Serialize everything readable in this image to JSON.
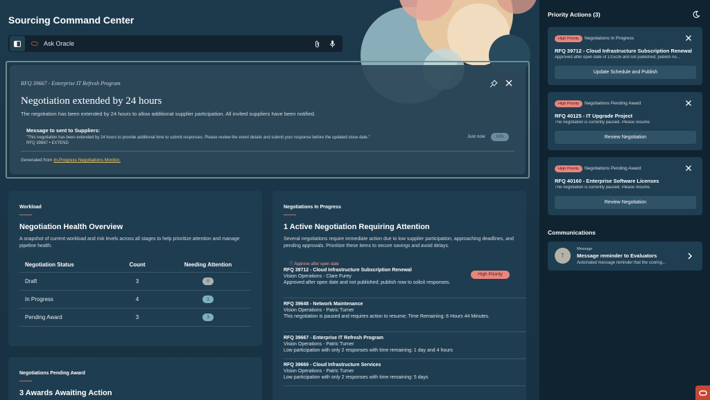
{
  "app": {
    "title": "Sourcing Command Center"
  },
  "search": {
    "placeholder": "Ask Oracle"
  },
  "alert": {
    "rfq": "RFQ 39667 - Enterprise IT Refresh Program",
    "headline": "Negotiation extended by 24 hours",
    "subtitle": "The negotiation has been extended by 24 hours to allow additional supplier participation. All invited suppliers have been notified.",
    "message_title": "Message to sent to Suppliers:",
    "message_body": "\"This negotiation has been extended by 24 hours to provide additional time to submit responses. Please review the event details and submit your response before the updated close date.\"",
    "message_ref": "RFQ 39667 • EXTEND",
    "time": "Just now",
    "tag": "Info",
    "generated_prefix": "Generated from",
    "generated_link": "In-Progress Negotiations Monitor."
  },
  "workload": {
    "kicker": "Workload",
    "title": "Negotiation Health Overview",
    "desc": "A snapshot of current workload and risk levels across all stages to help prioritize attention and manage pipeline health.",
    "columns": [
      "Negotiation Status",
      "Count",
      "Needing Attention"
    ],
    "rows": [
      {
        "status": "Draft",
        "count": "3",
        "attention": "0"
      },
      {
        "status": "In Progress",
        "count": "4",
        "attention": "1"
      },
      {
        "status": "Pending Award",
        "count": "3",
        "attention": "3"
      }
    ]
  },
  "pending_award": {
    "kicker": "Negotiations Pending Award",
    "title": "3 Awards Awaiting Action"
  },
  "in_progress": {
    "kicker": "Negotiations In Progress",
    "title": "1 Active Negotiation Requiring Attention",
    "desc": "Several negotiations require immediate action due to low supplier participation, approaching deadlines, and pending approvals. Prioritize these items to secure savings and avoid delays.",
    "flag": "Approve after open date",
    "badge": "High Priority",
    "items": [
      {
        "title": "RFQ 39712 - Cloud Infrastructure Subscription Renewal",
        "owner": "Vision Operations - Clare Furey",
        "desc": "Approved after open date and not published; publish now to solicit responses."
      },
      {
        "title": "RFQ 39648 - Network Maintenance",
        "owner": "Vision Operations - Patric Turner",
        "desc": "This negotiation is paused and requires action to resume; Time Remaining: 6 Hours 44 Minutes."
      },
      {
        "title": "RFQ 39667 - Enterprise IT Refresh Program",
        "owner": "Vision Operations - Patric Turner",
        "desc": "Low participation with only 2 responses with time remaining: 1 day and 4 hours"
      },
      {
        "title": "RFQ 39669 - Cloud Infrastructure Services",
        "owner": "Vision Operations - Patric Turner",
        "desc": "Low participation with only 2 responses with time remaining: 5 days"
      }
    ]
  },
  "priority": {
    "title": "Priority Actions (3)",
    "cards": [
      {
        "badge": "High Priority",
        "status": "Negotiations In Progress",
        "title": "RFQ 39712 - Cloud Infrastructure Subscription Renewal",
        "desc": "Approved after open date of 1/15/26 and not published; publish no...",
        "button": "Update Schedule and Publish"
      },
      {
        "badge": "High Priority",
        "status": "Negotiations Pending Award",
        "title": "RFQ 40125 - IT Upgrade Project",
        "desc": "The negotiation is currently paused. Please resume.",
        "button": "Review Negotiation"
      },
      {
        "badge": "High Priority",
        "status": "Negotiations Pending Award",
        "title": "RFQ 40160 - Enterprise Software Licenses",
        "desc": "The negotiation is currently paused. Please resume.",
        "button": "Review Negotiation"
      }
    ]
  },
  "communications": {
    "title": "Communications",
    "message": {
      "avatar": "T",
      "label": "Message",
      "title": "Message reminder to Evaluators",
      "desc": "Automated message reminder that the scoring..."
    }
  },
  "colors": {
    "accent": "#c74634",
    "badge": "#e8857d",
    "bg": "#1a3445",
    "panel": "#0f2331"
  }
}
